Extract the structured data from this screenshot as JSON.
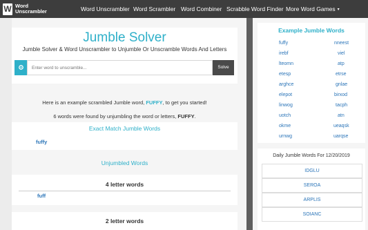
{
  "nav": {
    "logo_letter": "W",
    "logo_line1": "Word",
    "logo_line2": "Unscrambler",
    "items": [
      "Word Unscrambler",
      "Word Scrambler",
      "Word Combiner",
      "Scrabble Word Finder",
      "More Word Games"
    ],
    "caret": "▾"
  },
  "main": {
    "title": "Jumble Solver",
    "subtitle": "Jumble Solver & Word Unscrambler to Unjumble Or Unscramble Words And Letters",
    "search": {
      "placeholder": "Enter word to unscramble...",
      "value": "",
      "icon": "gear-icon",
      "button": "Solve"
    },
    "example_intro_pre": "Here is an example scrambled Jumble word, ",
    "example_word": "FUFFY",
    "example_intro_post": ", to get you started!",
    "found_pre": "6 words were found by unjumbling the word or letters, ",
    "found_word": "FUFFY",
    "found_post": ".",
    "exact_title": "Exact Match Jumble Words",
    "exact_words": [
      "fuffy"
    ],
    "unjumbled_title": "Unjumbled Words",
    "groups": [
      {
        "title": "4 letter words",
        "words": [
          "fuff"
        ]
      },
      {
        "title": "2 letter words",
        "words": []
      }
    ]
  },
  "sidebar": {
    "title": "Example Jumble Words",
    "left": [
      "fuffy",
      "irebf",
      "lteomn",
      "etesp",
      "arghce",
      "elepot",
      "linwog",
      "uotch",
      "okme",
      "urnwg"
    ],
    "right": [
      "nneest",
      "viel",
      "atp",
      "etrse",
      "gnlae",
      "birxod",
      "tacph",
      "atn",
      "ueaqsk",
      "uarqse"
    ],
    "daily_title": "Daily Jumble Words For 12/20/2019",
    "daily": [
      "IDGLU",
      "SEROA",
      "ARPLIS",
      "SOIANC"
    ]
  },
  "colors": {
    "accent": "#2eb0c9",
    "nav_bg": "#3d3d3d",
    "link": "#2a74b8"
  }
}
